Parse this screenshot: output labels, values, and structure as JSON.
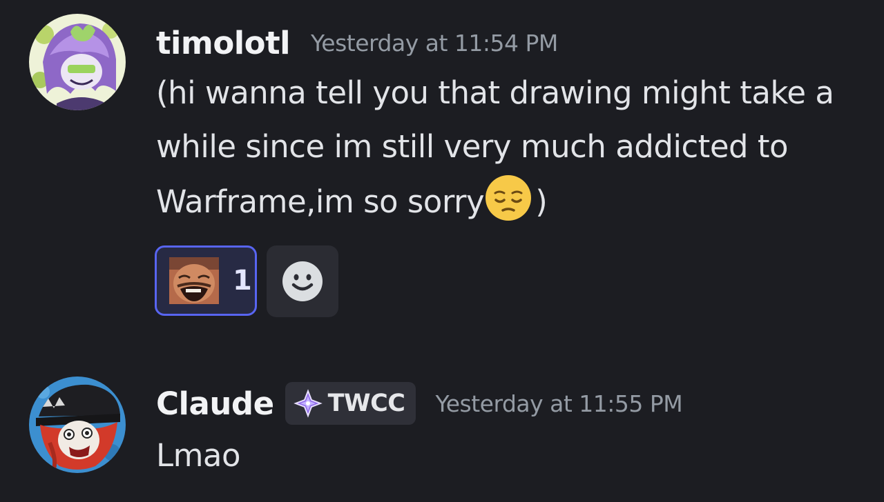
{
  "messages": [
    {
      "username": "timolotl",
      "timestamp": "Yesterday at 11:54 PM",
      "avatar_icon": "purple-hair-character-avatar",
      "body_main": "(hi wanna tell you that drawing might take a while since im still very much addicted to Warframe,im so sorry",
      "body_emoji": "pensive-face-emoji",
      "body_end": ")",
      "reactions": [
        {
          "emoji": "laughing-man-custom-emoji",
          "count": "1",
          "reacted": true
        }
      ],
      "add_reaction_icon": "smiley-add-reaction-icon"
    },
    {
      "username": "Claude",
      "tag": {
        "icon": "purple-sparkle-diamond-icon",
        "label": "TWCC"
      },
      "timestamp": "Yesterday at 11:55 PM",
      "avatar_icon": "red-hair-character-avatar",
      "body_main": "Lmao"
    }
  ],
  "colors": {
    "background": "#1c1d22",
    "username": "#f2f3f5",
    "timestamp": "#949ba4",
    "reaction_border": "#5865f2",
    "reaction_bg": "#272a44"
  }
}
